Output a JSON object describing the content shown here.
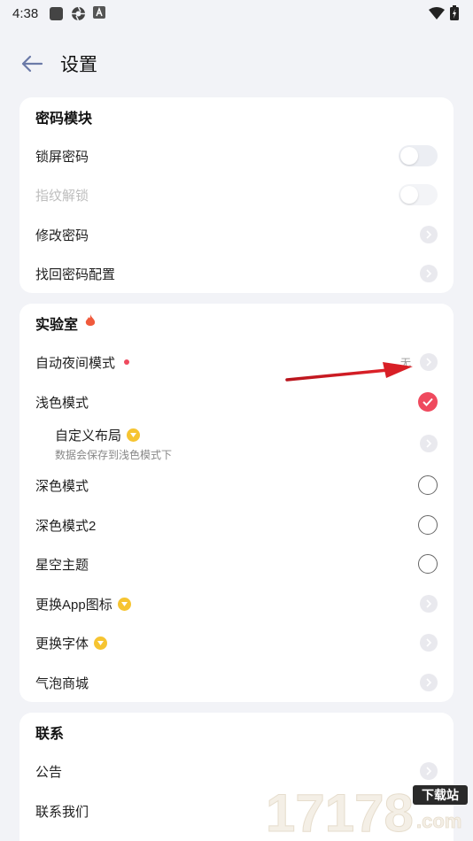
{
  "status": {
    "time": "4:38"
  },
  "header": {
    "title": "设置"
  },
  "password": {
    "title": "密码模块",
    "lock_screen": "锁屏密码",
    "fingerprint": "指纹解锁",
    "change": "修改密码",
    "recover": "找回密码配置"
  },
  "lab": {
    "title": "实验室",
    "auto_night": "自动夜间模式",
    "auto_night_value": "无",
    "light": "浅色模式",
    "custom_layout": "自定义布局",
    "custom_layout_sub": "数据会保存到浅色模式下",
    "dark": "深色模式",
    "dark2": "深色模式2",
    "starry": "星空主题",
    "app_icon": "更换App图标",
    "font": "更换字体",
    "bubble": "气泡商城"
  },
  "contact": {
    "title": "联系",
    "notice": "公告",
    "contact_us": "联系我们"
  },
  "watermark": {
    "text": "17178",
    "site": "下载站",
    "domain": ".com"
  },
  "colors": {
    "accent": "#ef4a5e",
    "vip": "#f6c431",
    "fire": "#f05a3c"
  }
}
